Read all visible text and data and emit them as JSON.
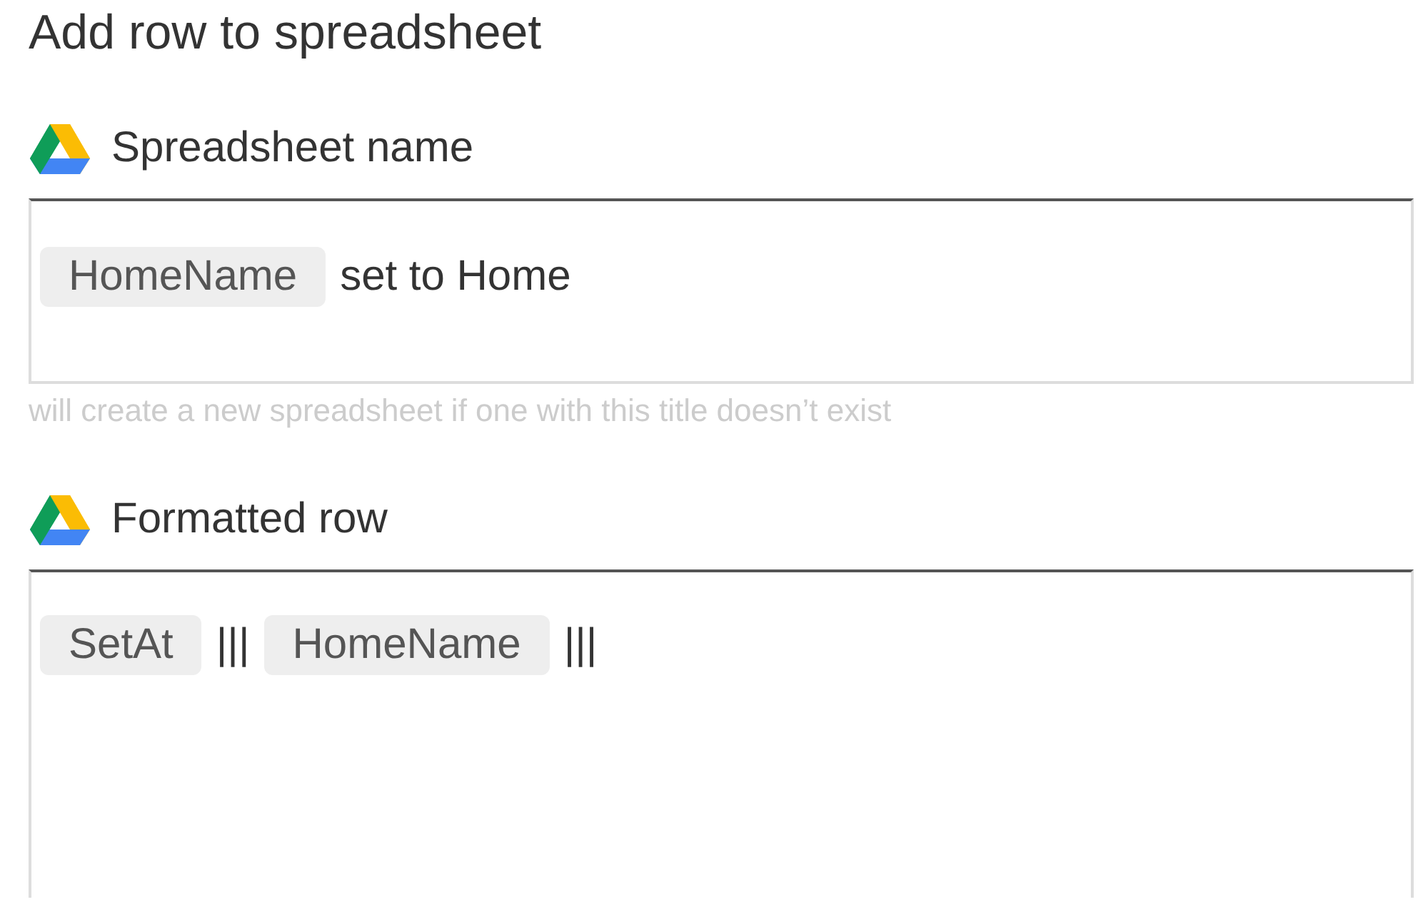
{
  "title": "Add row to spreadsheet",
  "fields": [
    {
      "label": "Spreadsheet name",
      "tokens": [
        {
          "kind": "ingredient",
          "text": "HomeName"
        },
        {
          "kind": "text",
          "text": "set to Home"
        }
      ],
      "helper": "will create a new spreadsheet if one with this title doesn’t exist"
    },
    {
      "label": "Formatted row",
      "tokens": [
        {
          "kind": "ingredient",
          "text": "SetAt"
        },
        {
          "kind": "text",
          "text": "|||"
        },
        {
          "kind": "ingredient",
          "text": "HomeName"
        },
        {
          "kind": "text",
          "text": "|||"
        }
      ]
    }
  ]
}
